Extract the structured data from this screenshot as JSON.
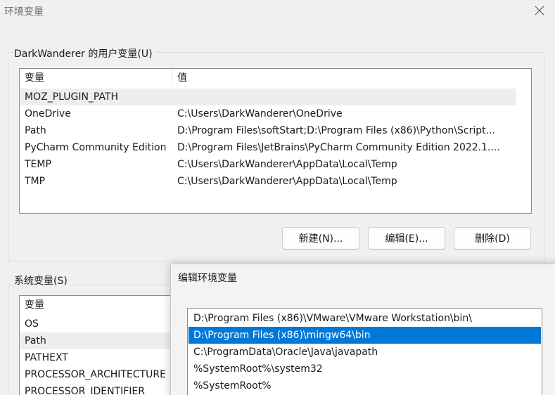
{
  "window": {
    "title": "环境变量"
  },
  "user_group": {
    "label": "DarkWanderer 的用户变量(U)",
    "headers": [
      "变量",
      "值"
    ],
    "rows": [
      {
        "name": "MOZ_PLUGIN_PATH",
        "value": ""
      },
      {
        "name": "OneDrive",
        "value": "C:\\Users\\DarkWanderer\\OneDrive"
      },
      {
        "name": "Path",
        "value": "D:\\Program Files\\softStart;D:\\Program Files (x86)\\Python\\Script..."
      },
      {
        "name": "PyCharm Community Edition",
        "value": "D:\\Program Files\\JetBrains\\PyCharm Community Edition 2022.1...."
      },
      {
        "name": "TEMP",
        "value": "C:\\Users\\DarkWanderer\\AppData\\Local\\Temp"
      },
      {
        "name": "TMP",
        "value": "C:\\Users\\DarkWanderer\\AppData\\Local\\Temp"
      }
    ],
    "buttons": {
      "new": "新建(N)...",
      "edit": "编辑(E)...",
      "delete": "删除(D)"
    }
  },
  "system_group": {
    "label": "系统变量(S)",
    "header": "变量",
    "rows": [
      "OS",
      "Path",
      "PATHEXT",
      "PROCESSOR_ARCHITECTURE",
      "PROCESSOR_IDENTIFIER"
    ]
  },
  "edit_dialog": {
    "title": "编辑环境变量",
    "items": [
      "D:\\Program Files (x86)\\VMware\\VMware Workstation\\bin\\",
      "D:\\Program Files (x86)\\mingw64\\bin",
      "C:\\ProgramData\\Oracle\\Java\\javapath",
      "%SystemRoot%\\system32",
      "%SystemRoot%"
    ]
  },
  "colors": {
    "selection": "#0078d7",
    "background": "#f0f0f0"
  }
}
